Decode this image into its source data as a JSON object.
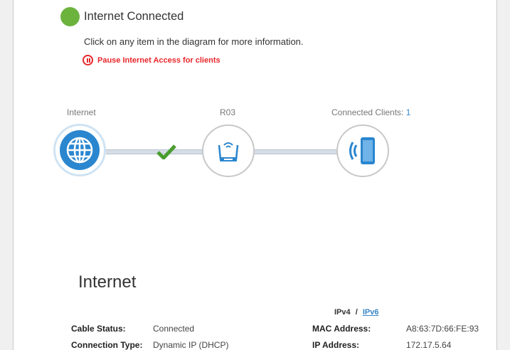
{
  "header": {
    "status_title": "Internet Connected",
    "status_color": "#6cb33e",
    "hint": "Click on any item in the diagram for more information.",
    "pause_label": "Pause Internet Access for clients"
  },
  "diagram": {
    "internet_label": "Internet",
    "router_label": "R03",
    "clients_label": "Connected Clients: ",
    "clients_count": "1",
    "accent": "#2a86cf"
  },
  "internet_section": {
    "title": "Internet",
    "ipv4": "IPv4",
    "sep": "/",
    "ipv6": "IPv6",
    "rows": [
      {
        "label": "Cable Status:",
        "value": "Connected"
      },
      {
        "label": "Connection Type:",
        "value": "Dynamic IP (DHCP)"
      },
      {
        "label": "MAC Address:",
        "value": "A8:63:7D:66:FE:93"
      },
      {
        "label": "IP Address:",
        "value": "172.17.5.64"
      }
    ]
  }
}
